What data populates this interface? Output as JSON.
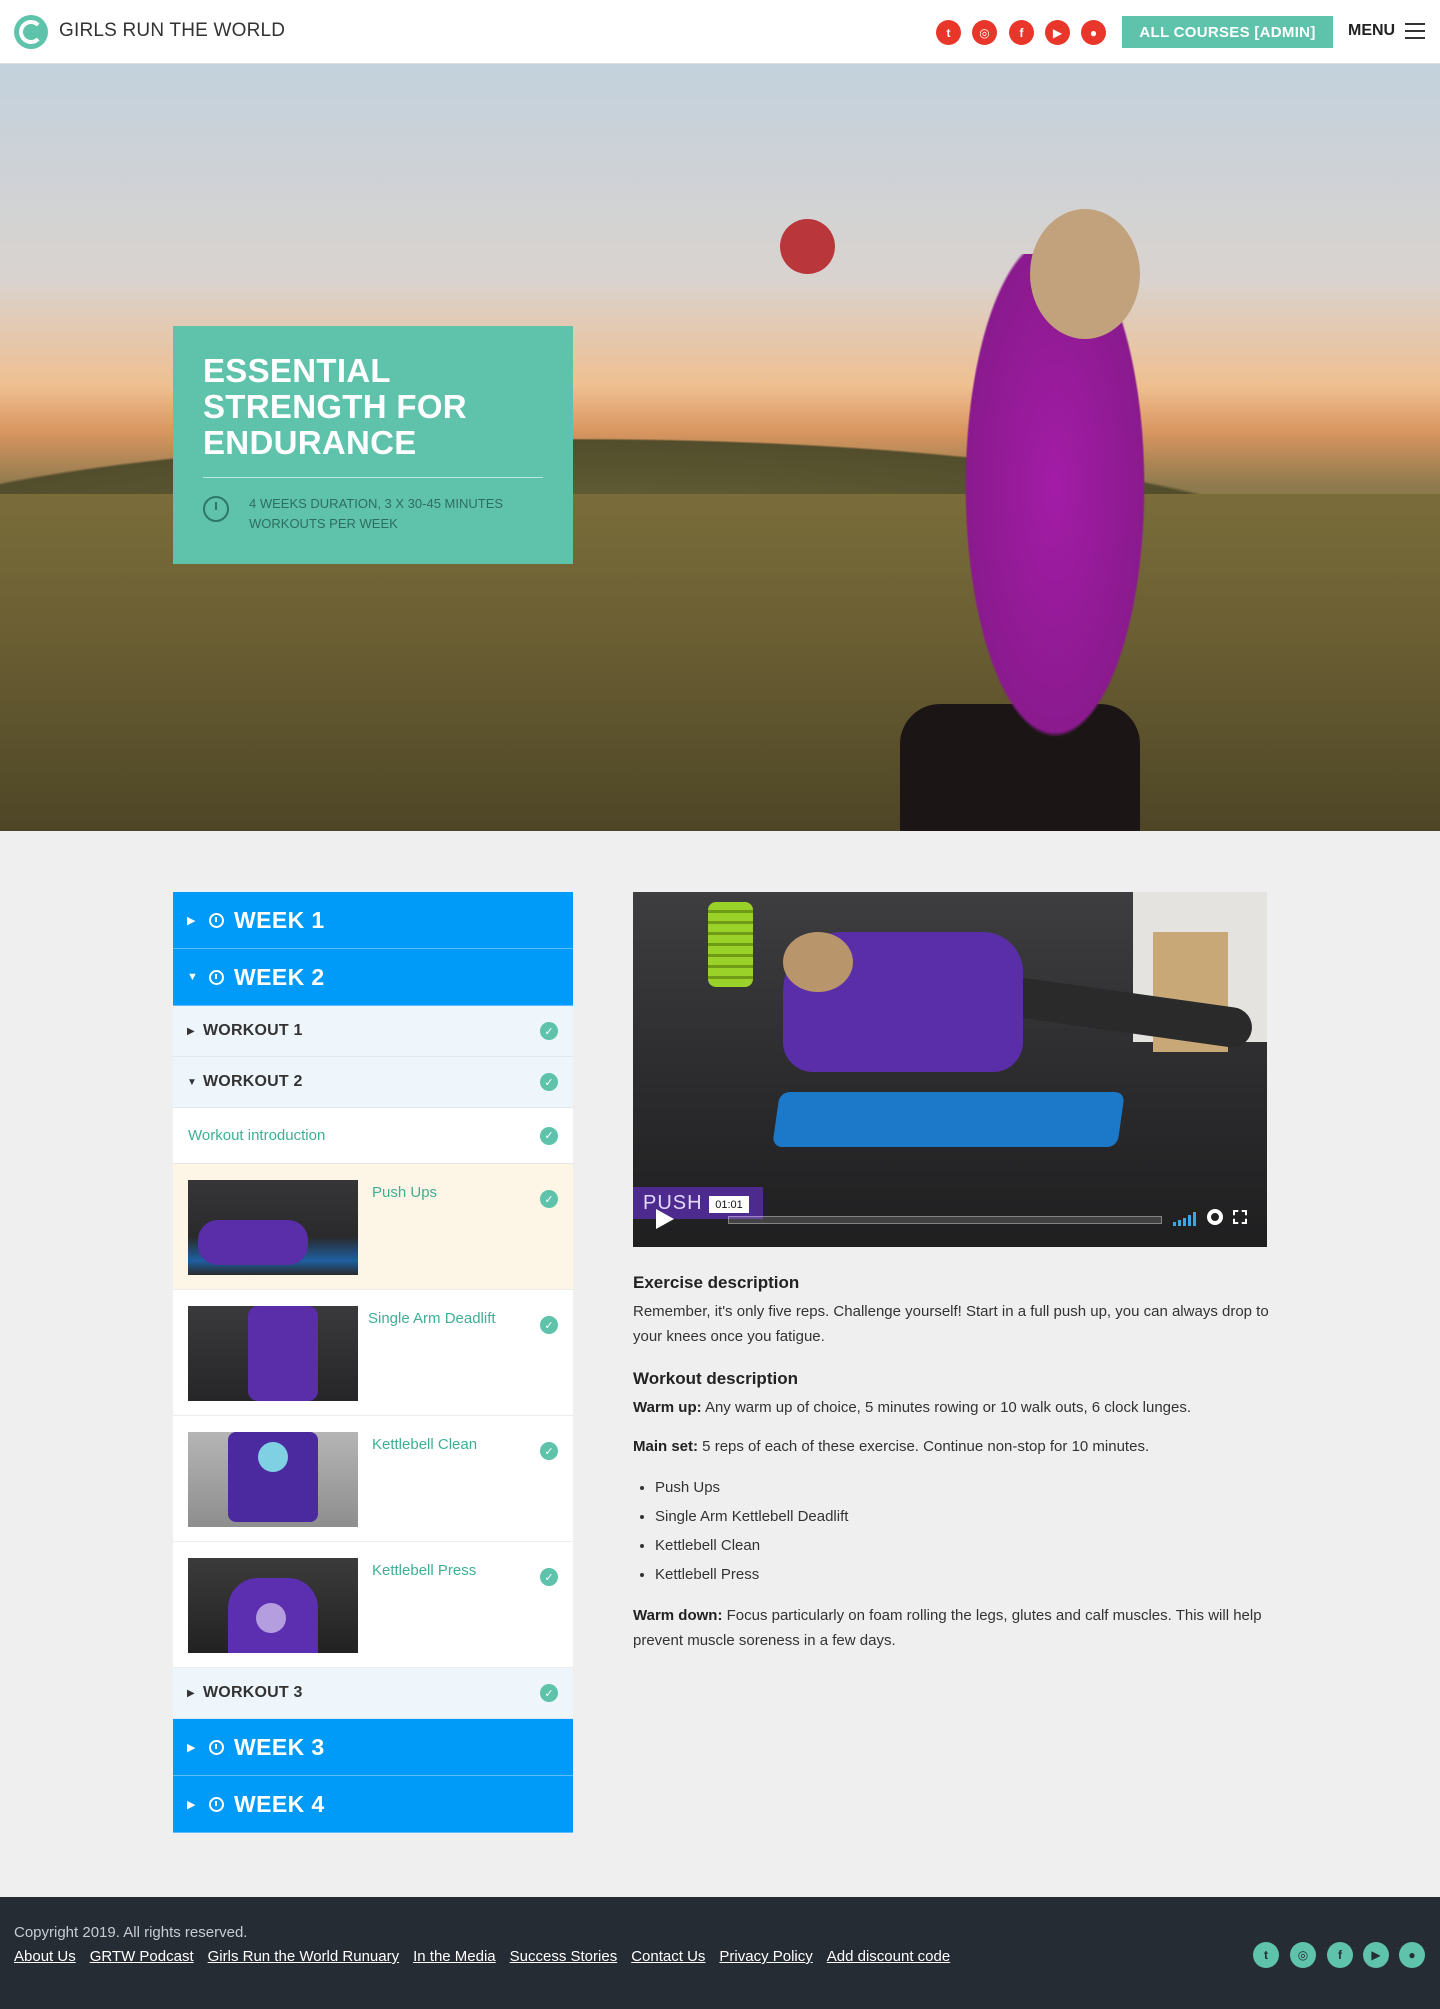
{
  "header": {
    "brand": "GIRLS RUN THE WORLD",
    "admin_button": "ALL COURSES [ADMIN]",
    "menu_label": "MENU",
    "social_icons": [
      "twitter-icon",
      "instagram-icon",
      "facebook-icon",
      "youtube-icon",
      "podcast-icon"
    ]
  },
  "hero": {
    "title": "ESSENTIAL STRENGTH FOR ENDURANCE",
    "meta": "4 WEEKS DURATION, 3 X 30-45 MINUTES WORKOUTS PER WEEK"
  },
  "sidebar": {
    "weeks": [
      {
        "label": "WEEK 1",
        "expanded": false
      },
      {
        "label": "WEEK 2",
        "expanded": true
      },
      {
        "label": "WEEK 3",
        "expanded": false
      },
      {
        "label": "WEEK 4",
        "expanded": false
      }
    ],
    "workouts": [
      {
        "label": "WORKOUT 1",
        "expanded": false,
        "completed": true
      },
      {
        "label": "WORKOUT 2",
        "expanded": true,
        "completed": true
      },
      {
        "label": "WORKOUT 3",
        "expanded": false,
        "completed": true
      }
    ],
    "intro": {
      "label": "Workout introduction",
      "completed": true
    },
    "exercises": [
      {
        "name": "Push Ups",
        "active": true,
        "completed": true
      },
      {
        "name": "Single Arm Deadlift",
        "active": false,
        "completed": true
      },
      {
        "name": "Kettlebell Clean",
        "active": false,
        "completed": true
      },
      {
        "name": "Kettlebell Press",
        "active": false,
        "completed": true
      }
    ]
  },
  "video": {
    "tag": "PUSH",
    "time": "01:01"
  },
  "description": {
    "exercise_heading": "Exercise description",
    "exercise_text": "Remember, it's only five reps. Challenge yourself! Start in a full push up, you can always drop to your knees once you fatigue.",
    "workout_heading": "Workout description",
    "warmup_label": "Warm up:",
    "warmup_text": " Any warm up of choice, 5 minutes rowing or 10 walk outs, 6 clock lunges.",
    "mainset_label": "Main set:",
    "mainset_text": " 5 reps of each of these exercise. Continue non-stop for 10 minutes.",
    "list": [
      "Push Ups",
      "Single Arm Kettlebell Deadlift",
      "Kettlebell Clean",
      "Kettlebell Press"
    ],
    "warmdown_label": "Warm down:",
    "warmdown_text": " Focus particularly on foam rolling the legs, glutes and calf muscles. This will help prevent muscle soreness in a few days."
  },
  "footer": {
    "copyright": "Copyright 2019. All rights reserved.",
    "links": [
      "About Us",
      "GRTW Podcast",
      "Girls Run the World Runuary",
      "In the Media",
      "Success Stories",
      "Contact Us",
      "Privacy Policy",
      "Add discount code"
    ]
  },
  "colors": {
    "accent_teal": "#5fc2aa",
    "week_blue": "#009af8",
    "social_red": "#e8372a",
    "footer_bg": "#262c33"
  }
}
